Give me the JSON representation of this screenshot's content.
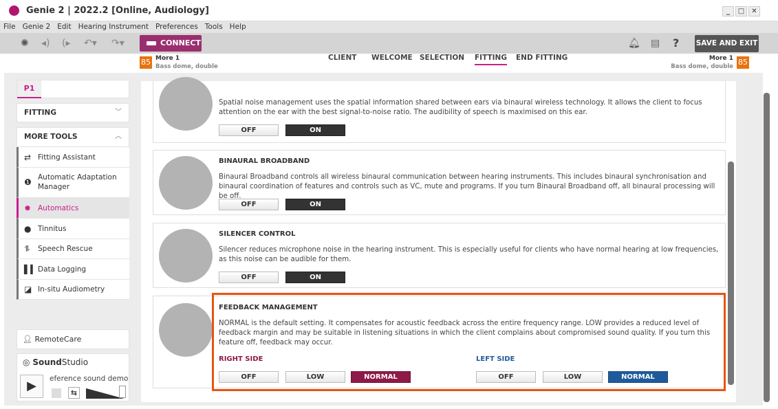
{
  "window": {
    "title": "Genie 2 | 2022.2 [Online, Audiology]",
    "controls": [
      "_",
      "□",
      "✕"
    ]
  },
  "menu": [
    "File",
    "Genie 2",
    "Edit",
    "Hearing Instrument",
    "Preferences",
    "Tools",
    "Help"
  ],
  "toolbar": {
    "connect": "CONNECT",
    "save_exit": "SAVE AND EXIT",
    "help": "?"
  },
  "right_instrument": {
    "level": "85",
    "program": "More 1",
    "dome": "Bass dome, double"
  },
  "left_instrument": {
    "level": "85",
    "program": "More 1",
    "dome": "Bass dome, double"
  },
  "nav": {
    "tabs": [
      "CLIENT",
      "WELCOME",
      "SELECTION",
      "FITTING",
      "END FITTING"
    ],
    "active": "FITTING"
  },
  "sidebar": {
    "program_tab": "P1",
    "fitting": "FITTING",
    "more_tools": "MORE TOOLS",
    "items": [
      {
        "label": "Fitting Assistant",
        "icon": "sliders-icon"
      },
      {
        "label": "Automatic Adaptation Manager",
        "icon": "adaptation-icon"
      },
      {
        "label": "Automatics",
        "icon": "gear-icon",
        "selected": true
      },
      {
        "label": "Tinnitus",
        "icon": "head-icon"
      },
      {
        "label": "Speech Rescue",
        "icon": "speech-rescue-icon"
      },
      {
        "label": "Data Logging",
        "icon": "bar-chart-icon"
      },
      {
        "label": "In-situ Audiometry",
        "icon": "audiometry-icon"
      }
    ],
    "remotecare": "RemoteCare",
    "soundstudio_bold": "Sound",
    "soundstudio_rest": "Studio",
    "demo": "eference sound demo"
  },
  "cards": [
    {
      "title": "",
      "desc": "Spatial noise management uses the spatial information shared between ears via binaural wireless technology. It allows the client to focus attention on the ear with the best signal-to-noise ratio. The audibility of speech is maximised on this ear.",
      "off": "OFF",
      "on": "ON",
      "value": "ON"
    },
    {
      "title": "BINAURAL BROADBAND",
      "desc": "Binaural Broadband controls all wireless binaural communication between hearing instruments. This includes binaural synchronisation and binaural coordination of features and controls such as VC, mute and programs. If you turn Binaural Broadband off, all binaural processing will be off.",
      "off": "OFF",
      "on": "ON",
      "value": "ON"
    },
    {
      "title": "SILENCER CONTROL",
      "desc": "Silencer reduces microphone noise in the hearing instrument. This is especially useful for clients who have normal hearing at low frequencies, as this noise can be audible for them.",
      "off": "OFF",
      "on": "ON",
      "value": "ON"
    }
  ],
  "feedback": {
    "title": "FEEDBACK MANAGEMENT",
    "desc": "NORMAL is the default setting. It compensates for acoustic feedback across the entire frequency range. LOW provides a reduced level of feedback margin and may be suitable in listening situations in which the client complains about compromised sound quality. If you turn this feature off, feedback may occur.",
    "right_label": "RIGHT SIDE",
    "left_label": "LEFT SIDE",
    "options": [
      "OFF",
      "LOW",
      "NORMAL"
    ],
    "right_value": "NORMAL",
    "left_value": "NORMAL",
    "right_color": "#8e1a48",
    "left_color": "#1f5b9a",
    "highlight_color": "#e8530f"
  }
}
